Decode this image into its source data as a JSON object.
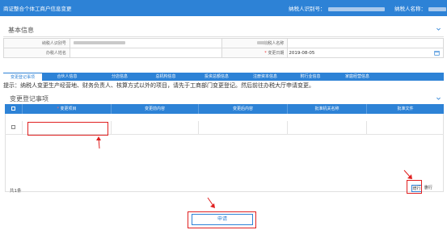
{
  "header": {
    "title": "商证整合个体工商户信息变更",
    "taxpayer_id_label": "纳税人识别号：",
    "taxpayer_name_label": "纳税人名称："
  },
  "basic_info": {
    "section_title": "基本信息",
    "taxpayer_id_label": "纳税人识别号",
    "taxpayer_name_label": "纳税人名称",
    "agent_label": "办税人姓名",
    "change_date_label": "变更日期",
    "change_date_value": "2019-08-05"
  },
  "tabs": [
    {
      "label": "变更登记事项",
      "active": true
    },
    {
      "label": "合伙人信息",
      "active": false
    },
    {
      "label": "分店信息",
      "active": false
    },
    {
      "label": "总机构信息",
      "active": false
    },
    {
      "label": "投资总额信息",
      "active": false
    },
    {
      "label": "注册资本信息",
      "active": false
    },
    {
      "label": "附行业信息",
      "active": false
    },
    {
      "label": "家庭经营信息",
      "active": false
    }
  ],
  "hint": "提示：纳税人变更生产经营地、财务负责人、核算方式以外的项目，请先于工商部门变更登记。然后前往办税大厅申请变更。",
  "change_items": {
    "section_title": "变更登记事项",
    "columns": [
      "变更项目",
      "变更前内容",
      "变更后内容",
      "批准机关名称",
      "批准文件"
    ],
    "row_count_text": "共1条",
    "add_button": "增行",
    "delete_button": "删行"
  },
  "submit_button": "申请",
  "colors": {
    "primary": "#2d82d6",
    "highlight": "#e02020"
  }
}
